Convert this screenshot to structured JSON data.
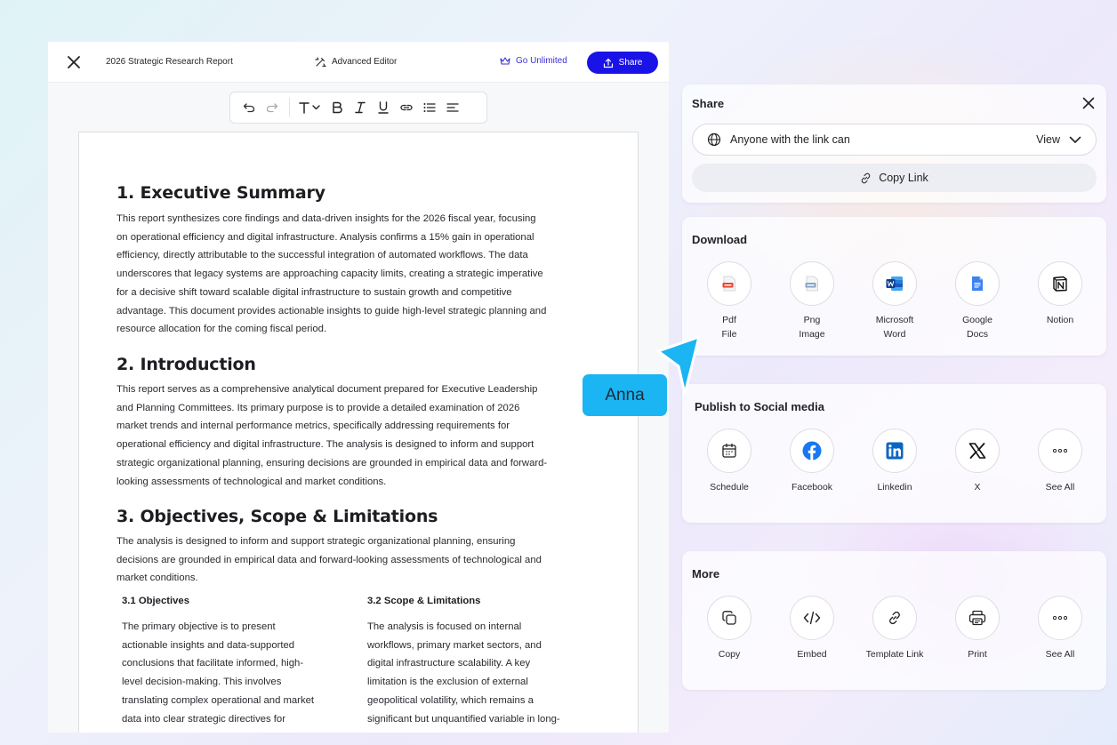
{
  "editor": {
    "doc_title": "2026 Strategic Research Report",
    "advanced_editor": "Advanced Editor",
    "go_unlimited": "Go Unlimited",
    "share": "Share"
  },
  "document": {
    "s1_heading": "1. Executive Summary",
    "s1_lines": [
      "This report synthesizes core findings and data-driven insights for the 2026 fiscal year, focusing",
      "on operational efficiency and digital infrastructure. Analysis confirms a 15% gain in operational",
      "efficiency, directly attributable to the successful integration of automated workflows. The data",
      "underscores that legacy systems are approaching capacity limits, creating a strategic imperative",
      "for a decisive shift toward scalable digital infrastructure to sustain growth and competitive",
      "advantage. This document provides actionable insights to guide high-level strategic planning and",
      "resource allocation for the coming fiscal period."
    ],
    "s2_heading": "2. Introduction",
    "s2_lines": [
      "This report serves as a comprehensive analytical document prepared for Executive Leadership",
      "and Planning Committees. Its primary purpose is to provide a detailed examination of 2026",
      "market trends and internal performance metrics, specifically addressing requirements for",
      "operational efficiency and digital infrastructure. The analysis is designed to inform and support",
      "strategic organizational planning, ensuring decisions are grounded in empirical data and forward-",
      "looking assessments of technological and market conditions."
    ],
    "s3_heading": "3. Objectives, Scope & Limitations",
    "s3_lines": [
      "The analysis is designed to inform and support strategic organizational planning, ensuring",
      "decisions are grounded in empirical data and forward-looking assessments of technological and",
      "market conditions."
    ],
    "s31_heading": "3.1 Objectives",
    "s31_lines": [
      "The primary objective is to present",
      "actionable insights and data-supported",
      "conclusions that facilitate informed, high-",
      "level decision-making. This involves",
      "translating complex operational and market",
      "data into clear strategic directives for"
    ],
    "s32_heading": "3.2 Scope & Limitations",
    "s32_lines": [
      "The analysis is focused on internal",
      "workflows, primary market sectors, and",
      "digital infrastructure scalability. A key",
      "limitation is the exclusion of external",
      "geopolitical volatility, which remains a",
      "significant but unquantified variable in long-"
    ]
  },
  "share_panel": {
    "title": "Share",
    "access_label": "Anyone with the link can",
    "permission": "View",
    "copy_link": "Copy Link"
  },
  "download": {
    "title": "Download",
    "items": [
      {
        "line1": "Pdf",
        "line2": "File",
        "icon": "pdf-file-icon"
      },
      {
        "line1": "Png",
        "line2": "Image",
        "icon": "png-image-icon"
      },
      {
        "line1": "Microsoft",
        "line2": "Word",
        "icon": "microsoft-word-icon"
      },
      {
        "line1": "Google",
        "line2": "Docs",
        "icon": "google-docs-icon"
      },
      {
        "line1": "Notion",
        "line2": "",
        "icon": "notion-icon"
      }
    ]
  },
  "social": {
    "title": "Publish to Social media",
    "items": [
      {
        "label": "Schedule",
        "icon": "calendar-icon"
      },
      {
        "label": "Facebook",
        "icon": "facebook-icon"
      },
      {
        "label": "Linkedin",
        "icon": "linkedin-icon"
      },
      {
        "label": "X",
        "icon": "x-icon"
      },
      {
        "label": "See All",
        "icon": "more-icon"
      }
    ]
  },
  "more": {
    "title": "More",
    "items": [
      {
        "label": "Copy",
        "icon": "copy-icon"
      },
      {
        "label": "Embed",
        "icon": "code-icon"
      },
      {
        "label": "Template Link",
        "icon": "link-icon"
      },
      {
        "label": "Print",
        "icon": "printer-icon"
      },
      {
        "label": "See All",
        "icon": "more-icon"
      }
    ]
  },
  "cursor": {
    "name": "Anna",
    "color": "#1ab5f2"
  },
  "colors": {
    "accent": "#1a13e8"
  }
}
